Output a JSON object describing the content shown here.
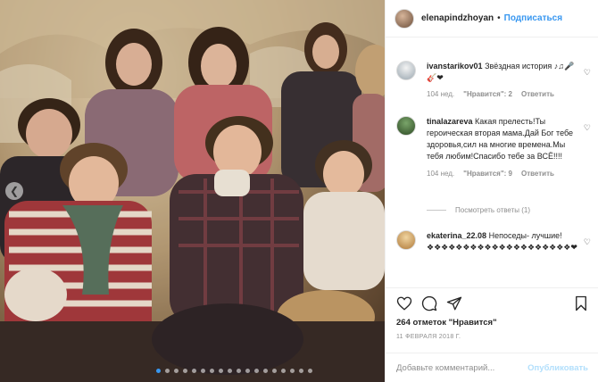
{
  "header": {
    "username": "elenapindzhoyan",
    "separator": "•",
    "follow_label": "Подписаться"
  },
  "comments": [
    {
      "username": "ivanstarikov01",
      "text": "Звёздная история ♪♫🎤🎸❤",
      "time": "104 нед.",
      "likes": "\"Нравится\": 2",
      "reply": "Ответить"
    },
    {
      "username": "tinalazareva",
      "text": "Какая прелесть!Ты героическая вторая мама.Дай Бог тебе здоровья,сил на многие времена.Мы тебя любим!Спасибо тебе за ВСЁ!!!!",
      "time": "104 нед.",
      "likes": "\"Нравится\": 9",
      "reply": "Ответить",
      "more_replies": "Посмотреть ответы (1)"
    },
    {
      "username": "ekaterina_22.08",
      "text": "Непоседы- лучшие! ❖❖❖❖❖❖❖❖❖❖❖❖❖❖❖❖❖❖❖❖❤"
    }
  ],
  "likes_text": "264 отметок \"Нравится\"",
  "date": "11 ФЕВРАЛЯ 2018 Г.",
  "comment_input": {
    "placeholder": "Добавьте комментарий...",
    "value": ""
  },
  "publish_label": "Опубликовать",
  "icons": {
    "like": "heart-icon",
    "comment": "comment-icon",
    "share": "share-icon",
    "save": "bookmark-icon",
    "prev": "chevron-left-icon"
  },
  "colors": {
    "link": "#3897f0",
    "muted": "#8e8e8e",
    "publish_disabled": "#b2dffc"
  },
  "carousel": {
    "slide_count": 18,
    "active_index": 0
  }
}
